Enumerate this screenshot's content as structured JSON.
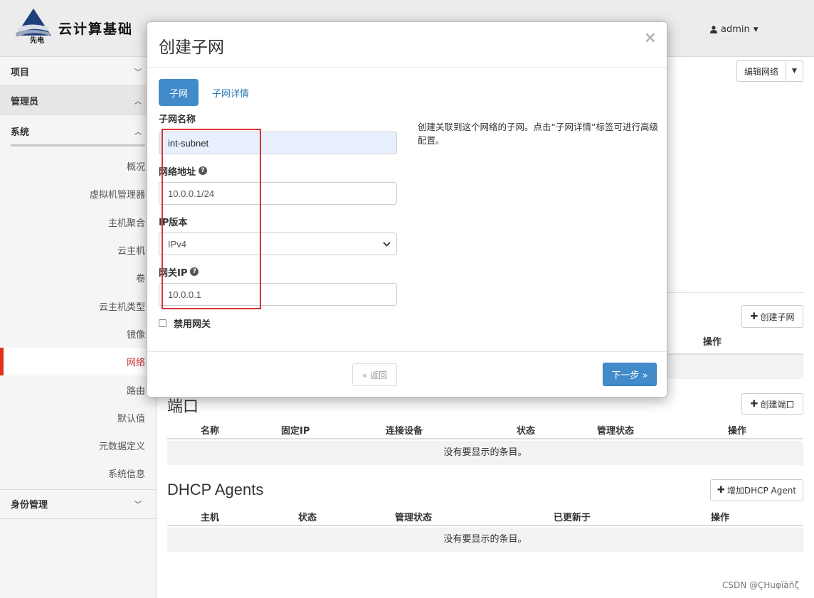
{
  "header": {
    "brand": "云计算基础",
    "logo_text": "先电",
    "user": "admin"
  },
  "sidebar": {
    "project": "项目",
    "admin": "管理员",
    "system": "系统",
    "items": [
      "概况",
      "虚拟机管理器",
      "主机聚合",
      "云主机",
      "卷",
      "云主机类型",
      "镜像",
      "网络",
      "路由",
      "默认值",
      "元数据定义",
      "系统信息"
    ],
    "active_item": "网络",
    "identity": "身份管理"
  },
  "main": {
    "edit_network": "编辑网络",
    "create_subnet": "创建子网",
    "subnet_ops": "操作",
    "ports": {
      "title": "端口",
      "create_button": "创建端口",
      "columns": [
        "名称",
        "固定IP",
        "连接设备",
        "状态",
        "管理状态",
        "操作"
      ],
      "empty": "没有要显示的条目。"
    },
    "dhcp": {
      "title": "DHCP Agents",
      "add_button": "增加DHCP Agent",
      "columns": [
        "主机",
        "状态",
        "管理状态",
        "已更新于",
        "操作"
      ],
      "empty": "没有要显示的条目。"
    }
  },
  "modal": {
    "title": "创建子网",
    "close": "×",
    "tabs": [
      "子网",
      "子网详情"
    ],
    "fields": {
      "subnet_name_label": "子网名称",
      "subnet_name_value": "int-subnet",
      "network_address_label": "网络地址",
      "network_address_value": "10.0.0.1/24",
      "ip_version_label": "IP版本",
      "ip_version_value": "IPv4",
      "gateway_ip_label": "网关IP",
      "gateway_ip_value": "10.0.0.1",
      "disable_gateway_label": "禁用网关"
    },
    "help_text": "创建关联到这个网络的子网。点击“子网详情”标签可进行高级配置。",
    "back_button": "« 返回",
    "next_button": "下一步 »"
  },
  "watermark": "CSDN @ÇHuφïàñζ",
  "colors": {
    "primary": "#428bca",
    "active_nav": "#e0301e",
    "highlight_box": "#d9323a"
  }
}
